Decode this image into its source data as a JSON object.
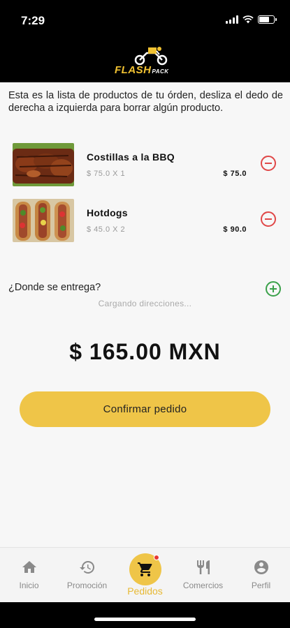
{
  "status_bar": {
    "time": "7:29"
  },
  "header": {
    "logo_text": "FLASH",
    "logo_subtext": "PACK"
  },
  "intro_text": "Esta es la lista de productos de tu órden, desliza el dedo de derecha a izquierda para borrar algún producto.",
  "items": [
    {
      "name": "Costillas a la BBQ",
      "qty": "$ 75.0 X 1",
      "total": "$ 75.0"
    },
    {
      "name": "Hotdogs",
      "qty": "$ 45.0 X 2",
      "total": "$ 90.0"
    }
  ],
  "delivery": {
    "label": "¿Donde se entrega?",
    "loading": "Cargando direcciones..."
  },
  "order_total": "$ 165.00 MXN",
  "confirm_label": "Confirmar pedido",
  "tabs": [
    {
      "label": "Inicio",
      "icon": "home-icon"
    },
    {
      "label": "Promoción",
      "icon": "history-icon"
    },
    {
      "label": "Pedidos",
      "icon": "cart-icon",
      "active": true
    },
    {
      "label": "Comercios",
      "icon": "restaurant-icon"
    },
    {
      "label": "Perfil",
      "icon": "account-icon"
    }
  ],
  "colors": {
    "accent": "#efc548",
    "remove": "#e04848",
    "add": "#3aa14a",
    "badge": "#e53935"
  }
}
